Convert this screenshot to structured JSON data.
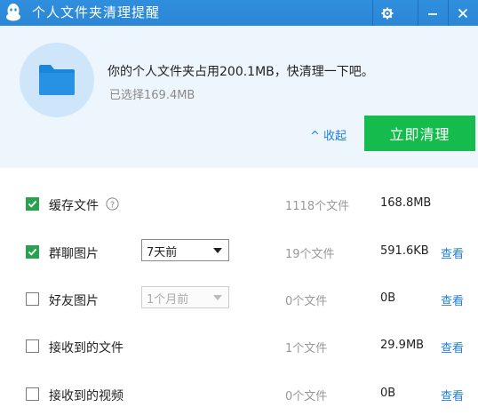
{
  "window": {
    "title": "个人文件夹清理提醒",
    "controls": [
      "gear-icon",
      "minimize-icon",
      "close-icon"
    ]
  },
  "header": {
    "message": "你的个人文件夹占用200.1MB，快清理一下吧。",
    "selected": "已选择169.4MB",
    "collapse_label": "收起",
    "clean_button": "立即清理"
  },
  "rows": [
    {
      "label": "缓存文件",
      "checked": true,
      "has_help": true,
      "count": "1118个文件",
      "size": "168.8MB",
      "view": ""
    },
    {
      "label": "群聊图片",
      "checked": true,
      "select": "7天前",
      "select_disabled": false,
      "count": "19个文件",
      "size": "591.6KB",
      "view": "查看"
    },
    {
      "label": "好友图片",
      "checked": false,
      "select": "1个月前",
      "select_disabled": true,
      "count": "0个文件",
      "size": "0B",
      "view": "查看"
    },
    {
      "label": "接收到的文件",
      "checked": false,
      "count": "1个文件",
      "size": "29.9MB",
      "view": "查看"
    },
    {
      "label": "接收到的视频",
      "checked": false,
      "count": "0个文件",
      "size": "0B",
      "view": "查看"
    }
  ],
  "colors": {
    "titlebar": "#2b86d6",
    "accent_link": "#1f7fd9",
    "clean_button": "#15bc4d",
    "checkbox_checked": "#2aa14f",
    "header_bg": "#eef6fd"
  }
}
